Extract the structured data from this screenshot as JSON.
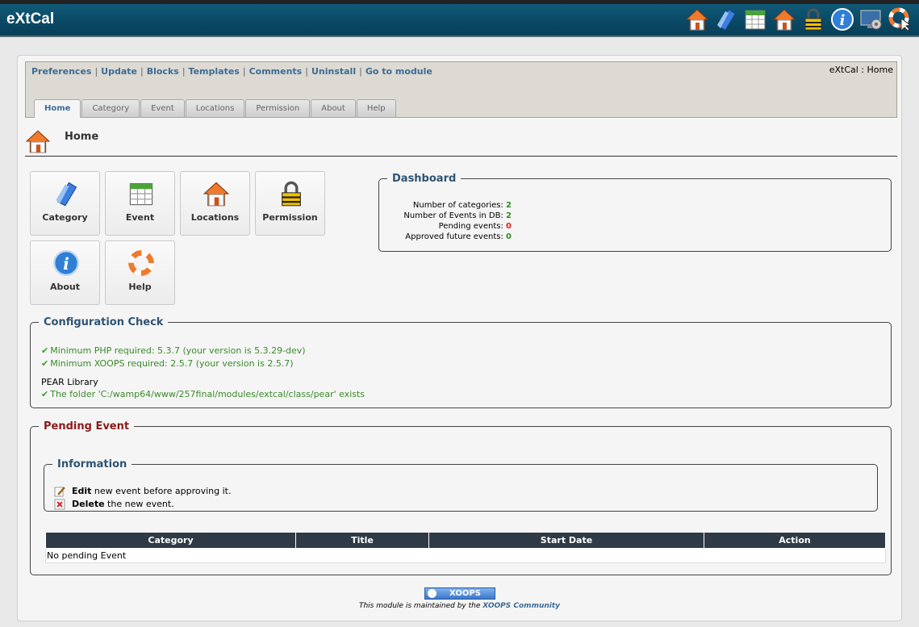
{
  "app": {
    "title": "eXtCal"
  },
  "top_icons": [
    "home-icon",
    "category-icon",
    "calendar-icon",
    "locations-icon",
    "lock-icon",
    "info-icon",
    "system-icon",
    "help-cursor-icon"
  ],
  "admin_links": {
    "preferences": "Preferences",
    "update": "Update",
    "blocks": "Blocks",
    "templates": "Templates",
    "comments": "Comments",
    "uninstall": "Uninstall",
    "goto": "Go to module"
  },
  "breadcrumb": "eXtCal : Home",
  "tabs": [
    "Home",
    "Category",
    "Event",
    "Locations",
    "Permission",
    "About",
    "Help"
  ],
  "page_title": "Home",
  "buttons": {
    "category": "Category",
    "event": "Event",
    "locations": "Locations",
    "permission": "Permission",
    "about": "About",
    "help": "Help"
  },
  "dashboard": {
    "title": "Dashboard",
    "rows": [
      {
        "label": "Number of categories:",
        "value": "2"
      },
      {
        "label": "Number of Events in DB:",
        "value": "2"
      },
      {
        "label": "Pending events:",
        "value": "0"
      },
      {
        "label": "Approved future events:",
        "value": "0"
      }
    ]
  },
  "config": {
    "title": "Configuration Check",
    "php": "Minimum PHP required: 5.3.7 (your version is 5.3.29-dev)",
    "xoops": "Minimum XOOPS required: 2.5.7 (your version is 2.5.7)",
    "pear_label": "PEAR Library",
    "pear_folder": "The folder 'C:/wamp64/www/257final/modules/extcal/class/pear' exists",
    "tick": "✔"
  },
  "pending": {
    "title": "Pending Event",
    "info_title": "Information",
    "edit_bold": "Edit",
    "edit_text": " new event before approving it.",
    "delete_bold": "Delete",
    "delete_text": " the new event.",
    "columns": [
      "Category",
      "Title",
      "Start Date",
      "Action"
    ],
    "empty": "No pending Event"
  },
  "footer": {
    "badge": "XOOPS",
    "text": "This module is maintained by the ",
    "link": "XOOPS Community"
  },
  "colors": {
    "header": "#0a4965",
    "link": "#3e6b96",
    "ok_green": "#2e8b22",
    "alert_red": "#e0201a",
    "pending_title": "#8b1a1a"
  }
}
